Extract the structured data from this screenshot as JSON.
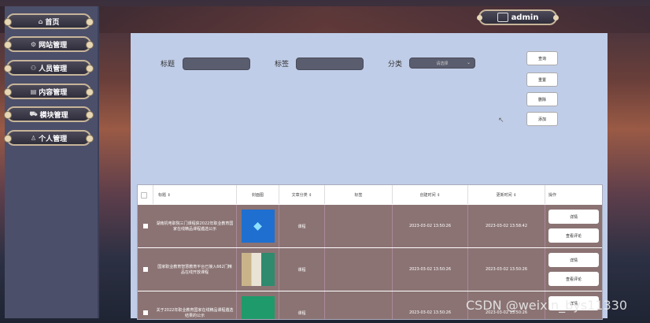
{
  "sidebar": {
    "items": [
      {
        "icon": "home-icon",
        "glyph": "⌂",
        "label": "首页"
      },
      {
        "icon": "gear-icon",
        "glyph": "⚙",
        "label": "网站管理"
      },
      {
        "icon": "user-icon",
        "glyph": "⚇",
        "label": "人员管理"
      },
      {
        "icon": "document-icon",
        "glyph": "▤",
        "label": "内容管理"
      },
      {
        "icon": "cart-icon",
        "glyph": "⛟",
        "label": "模块管理"
      },
      {
        "icon": "person-icon",
        "glyph": "♙",
        "label": "个人管理"
      }
    ]
  },
  "header": {
    "user": "admin"
  },
  "search": {
    "title_label": "标题",
    "tag_label": "标签",
    "category_label": "分类",
    "category_placeholder": "请选择"
  },
  "buttons": {
    "query": "查询",
    "reset": "重置",
    "delete": "删除",
    "add": "添加"
  },
  "table": {
    "headers": [
      "标题 ⇕",
      "封面图",
      "文章分类 ⇕",
      "标签",
      "创建时间 ⇕",
      "更新时间 ⇕",
      "操作"
    ],
    "rows": [
      {
        "title": "湖南机电职院三门课程获2022年职业教育国家在线精品课程遴选公示",
        "category": "课程",
        "tag": "",
        "created": "2023-03-02 13:50:26",
        "updated": "2023-03-02 13:58:42",
        "thumb_color": "#1e6fd0"
      },
      {
        "title": "国家职业教育智慧教育平台已接入662门精品在线开放课程",
        "category": "课程",
        "tag": "",
        "created": "2023-03-02 13:50:26",
        "updated": "2023-03-02 13:50:26",
        "thumb_color": "#c9b48a"
      },
      {
        "title": "关于2022年职业教育国家在线精品课程遴选结果的公示",
        "category": "课程",
        "tag": "",
        "created": "2023-03-02 13:50:26",
        "updated": "2023-03-02 13:50:26",
        "thumb_color": "#1f9a6a"
      }
    ],
    "actions": {
      "detail": "详情",
      "comments": "查看评论"
    }
  },
  "watermark": "CSDN @weixin_bys11330"
}
